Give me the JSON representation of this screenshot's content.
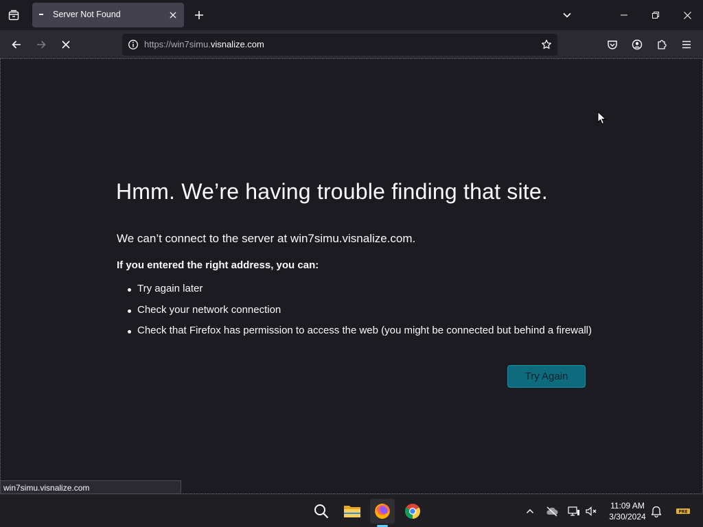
{
  "browser": {
    "tab": {
      "title": "Server Not Found"
    },
    "url": {
      "scheme": "https://",
      "host_prefix": "win7simu.",
      "host_main": "visnalize.com"
    }
  },
  "page": {
    "title": "Hmm. We’re having trouble finding that site.",
    "description": "We can’t connect to the server at win7simu.visnalize.com.",
    "subheading": "If you entered the right address, you can:",
    "suggestions": [
      "Try again later",
      "Check your network connection",
      "Check that Firefox has permission to access the web (you might be connected but behind a firewall)"
    ],
    "button": "Try Again",
    "button_color": "#0e6a7d"
  },
  "status_bar": {
    "text": "win7simu.visnalize.com"
  },
  "taskbar": {
    "apps": [
      "search-icon",
      "file-explorer-icon",
      "firefox-icon",
      "chrome-icon"
    ],
    "active_app": "firefox-icon",
    "clock": {
      "time": "11:09 AM",
      "date": "3/30/2024"
    },
    "tray_badge": "PRE"
  },
  "colors": {
    "background": "#1c1b22",
    "toolbar": "#2b2a33",
    "tab_active": "#42414d",
    "accent": "#60cdff"
  }
}
